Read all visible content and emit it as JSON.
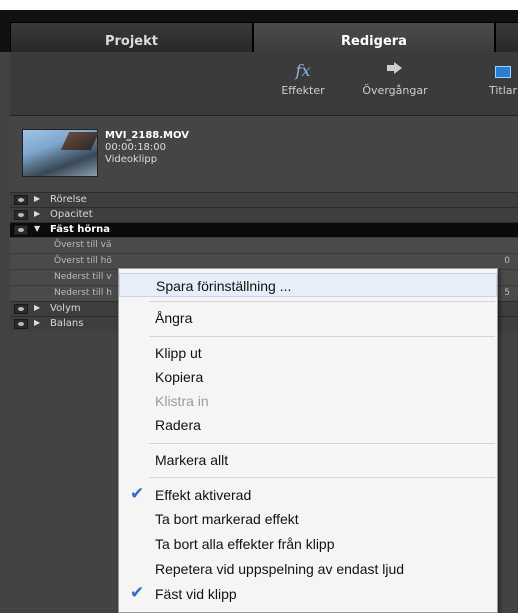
{
  "tabs": {
    "projekt": "Projekt",
    "redigera": "Redigera"
  },
  "toolbar": {
    "effects_label": "Effekter",
    "effects_glyph": "fx",
    "transitions_label": "Övergångar",
    "titles_label": "Titlar"
  },
  "clip": {
    "name": "MVI_2188.MOV",
    "duration": "00:00:18:00",
    "type": "Videoklipp"
  },
  "effects": {
    "rows": [
      {
        "label": "Rörelse"
      },
      {
        "label": "Opacitet"
      },
      {
        "label": "Fäst hörna"
      }
    ],
    "sub_rows": [
      {
        "label": "Överst till vä"
      },
      {
        "label": "Överst till hö"
      },
      {
        "label": "Nederst till v"
      },
      {
        "label": "Nederst till h"
      }
    ],
    "sub_values": [
      "0",
      "5"
    ],
    "rows_after": [
      {
        "label": "Volym"
      },
      {
        "label": "Balans"
      }
    ]
  },
  "menu": {
    "items": [
      {
        "label": "Spara förinställning ..."
      },
      {
        "label": "Ångra"
      },
      {
        "label": "Klipp ut"
      },
      {
        "label": "Kopiera"
      },
      {
        "label": "Klistra in"
      },
      {
        "label": "Radera"
      },
      {
        "label": "Markera allt"
      },
      {
        "label": "Effekt aktiverad",
        "checked": true
      },
      {
        "label": "Ta bort markerad effekt"
      },
      {
        "label": "Ta bort alla effekter från klipp"
      },
      {
        "label": "Repetera vid uppspelning av endast ljud"
      },
      {
        "label": "Fäst vid klipp",
        "checked": true
      }
    ],
    "check_glyph": "✔",
    "check_color": "#2b6fc2"
  }
}
